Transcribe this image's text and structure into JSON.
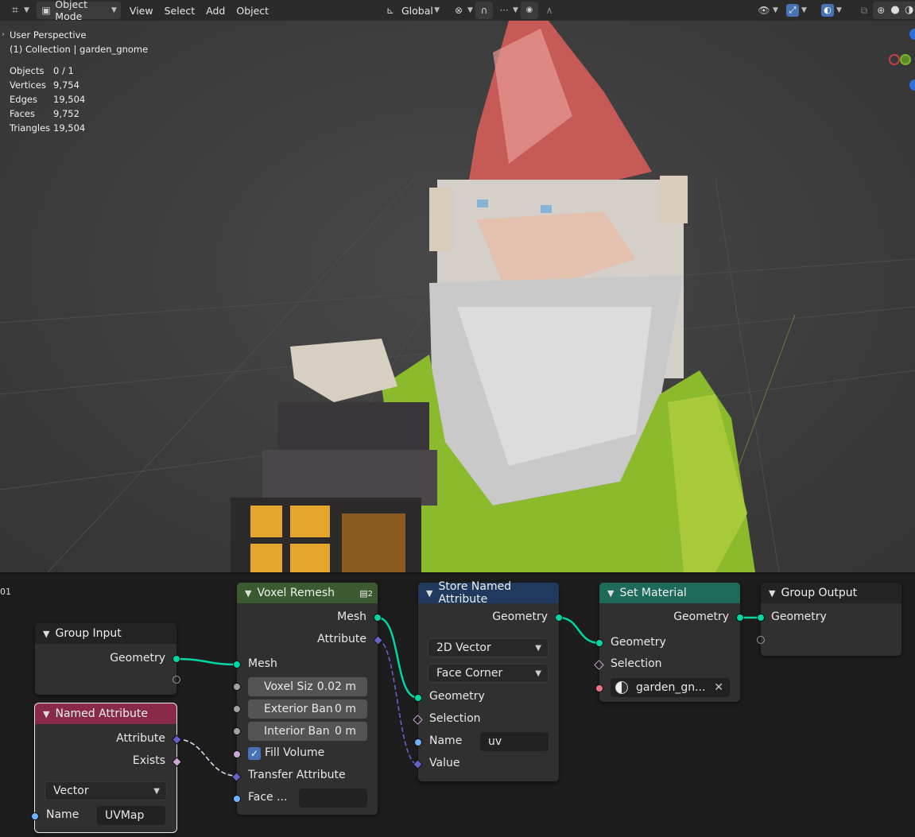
{
  "header": {
    "editor_type_icon": "grid-editor-icon",
    "mode": "Object Mode",
    "menus": [
      "View",
      "Select",
      "Add",
      "Object"
    ],
    "transform_orientation": "Global"
  },
  "viewport": {
    "perspective": "User Perspective",
    "collection": "(1) Collection | garden_gnome",
    "stats": [
      {
        "label": "Objects",
        "value": "0 / 1"
      },
      {
        "label": "Vertices",
        "value": "9,754"
      },
      {
        "label": "Edges",
        "value": "19,504"
      },
      {
        "label": "Faces",
        "value": "9,752"
      },
      {
        "label": "Triangles",
        "value": "19,504"
      }
    ]
  },
  "node_editor": {
    "corner_label": "01",
    "group_input": {
      "title": "Group Input",
      "geometry": "Geometry"
    },
    "named_attribute": {
      "title": "Named Attribute",
      "attribute": "Attribute",
      "exists": "Exists",
      "type": "Vector",
      "name_label": "Name",
      "name_value": "UVMap"
    },
    "voxel_remesh": {
      "title": "Voxel Remesh",
      "user_count": "2",
      "out_mesh": "Mesh",
      "out_attribute": "Attribute",
      "in_mesh": "Mesh",
      "voxel_size_label": "Voxel Siz",
      "voxel_size_value": "0.02 m",
      "exterior_label": "Exterior Ban",
      "exterior_value": "0 m",
      "interior_label": "Interior Ban",
      "interior_value": "0 m",
      "fill_volume": "Fill Volume",
      "transfer_attribute": "Transfer Attribute",
      "face_label": "Face ..."
    },
    "store_named_attribute": {
      "title": "Store Named Attribute",
      "out_geometry": "Geometry",
      "data_type": "2D Vector",
      "domain": "Face Corner",
      "in_geometry": "Geometry",
      "selection": "Selection",
      "name_label": "Name",
      "name_value": "uv",
      "value": "Value"
    },
    "set_material": {
      "title": "Set Material",
      "out_geometry": "Geometry",
      "in_geometry": "Geometry",
      "selection": "Selection",
      "material": "garden_gn..."
    },
    "group_output": {
      "title": "Group Output",
      "geometry": "Geometry"
    }
  },
  "colors": {
    "geometry_socket": "#00d6a3",
    "vector_socket": "#6363c7",
    "header_voxel": "#3b5a30",
    "header_store": "#1f3a5e",
    "header_setmat": "#1d6b58",
    "header_named": "#8a2a49"
  }
}
